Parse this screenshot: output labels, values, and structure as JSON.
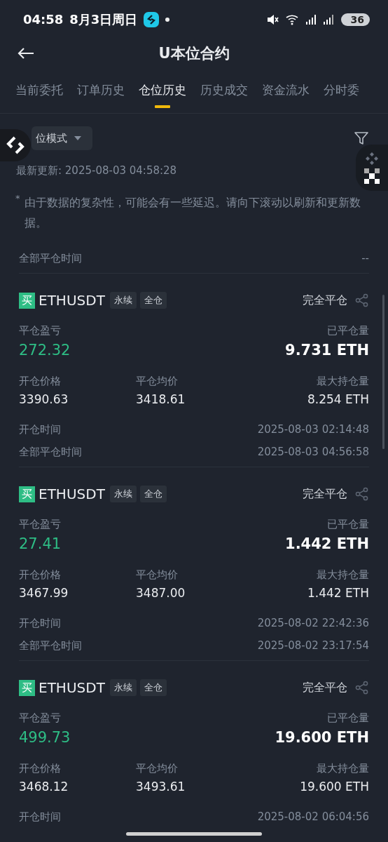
{
  "status_bar": {
    "time": "04:58",
    "date": "8月3日周日",
    "battery": "36"
  },
  "header": {
    "title": "U本位合约"
  },
  "tabs": [
    {
      "label": "当前委托",
      "selected": false
    },
    {
      "label": "订单历史",
      "selected": false
    },
    {
      "label": "仓位历史",
      "selected": true
    },
    {
      "label": "历史成交",
      "selected": false
    },
    {
      "label": "资金流水",
      "selected": false
    },
    {
      "label": "分时委",
      "selected": false
    }
  ],
  "mode_dropdown": {
    "label": "位模式"
  },
  "last_update": "最新更新: 2025-08-03 04:58:28",
  "note": {
    "mark": "*",
    "text": "由于数据的复杂性，可能会有一些延迟。请向下滚动以刷新和更新数据。"
  },
  "summary": {
    "label": "全部平仓时间",
    "value": "--"
  },
  "positions": [
    {
      "side": "买",
      "kind": "buy",
      "symbol": "ETHUSDT",
      "tags": [
        "永续",
        "全仓"
      ],
      "status": "完全平仓",
      "pnl_label": "平仓盈亏",
      "pnl": "272.32",
      "closed_label": "已平仓量",
      "closed": "9.731 ETH",
      "open_price_label": "开仓价格",
      "open_price": "3390.63",
      "avg_close_label": "平仓均价",
      "avg_close": "3418.61",
      "max_label": "最大持仓量",
      "max": "8.254 ETH",
      "times": [
        {
          "label": "开仓时间",
          "value": "2025-08-03 02:14:48"
        },
        {
          "label": "全部平仓时间",
          "value": "2025-08-03 04:56:58"
        }
      ]
    },
    {
      "side": "买",
      "kind": "buy",
      "symbol": "ETHUSDT",
      "tags": [
        "永续",
        "全仓"
      ],
      "status": "完全平仓",
      "pnl_label": "平仓盈亏",
      "pnl": "27.41",
      "closed_label": "已平仓量",
      "closed": "1.442 ETH",
      "open_price_label": "开仓价格",
      "open_price": "3467.99",
      "avg_close_label": "平仓均价",
      "avg_close": "3487.00",
      "max_label": "最大持仓量",
      "max": "1.442 ETH",
      "times": [
        {
          "label": "开仓时间",
          "value": "2025-08-02 22:42:36"
        },
        {
          "label": "全部平仓时间",
          "value": "2025-08-02 23:17:54"
        }
      ]
    },
    {
      "side": "买",
      "kind": "buy",
      "symbol": "ETHUSDT",
      "tags": [
        "永续",
        "全仓"
      ],
      "status": "完全平仓",
      "pnl_label": "平仓盈亏",
      "pnl": "499.73",
      "closed_label": "已平仓量",
      "closed": "19.600 ETH",
      "open_price_label": "开仓价格",
      "open_price": "3468.12",
      "avg_close_label": "平仓均价",
      "avg_close": "3493.61",
      "max_label": "最大持仓量",
      "max": "19.600 ETH",
      "times": [
        {
          "label": "开仓时间",
          "value": "2025-08-02 06:04:56"
        }
      ]
    }
  ]
}
